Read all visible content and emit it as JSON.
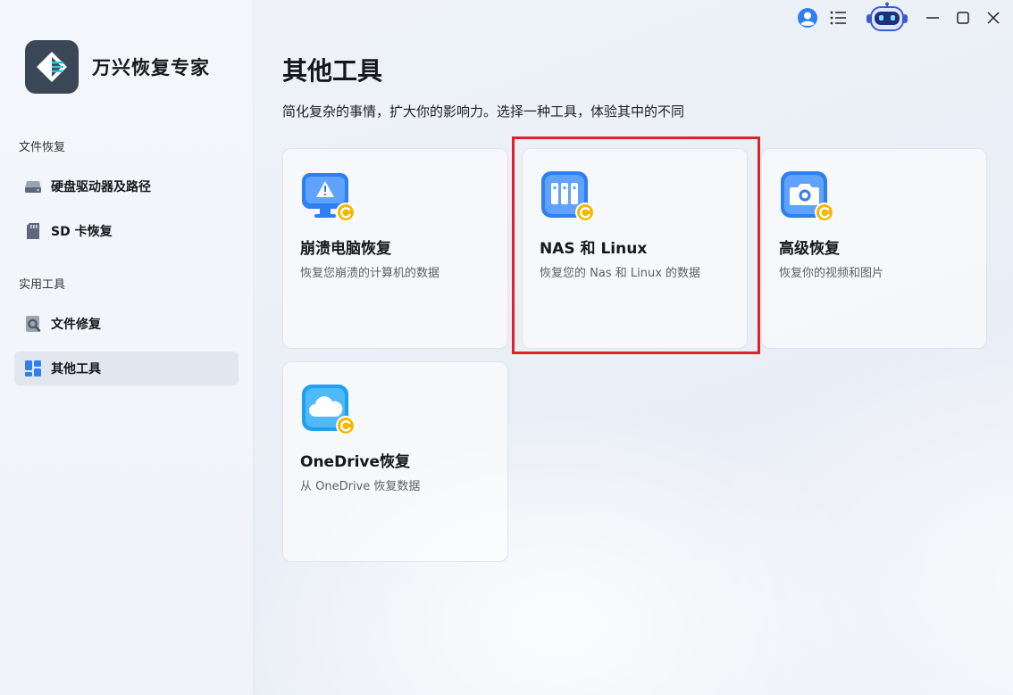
{
  "app": {
    "name": "万兴恢复专家"
  },
  "sidebar": {
    "sections": [
      {
        "label": "文件恢复"
      },
      {
        "label": "实用工具"
      }
    ],
    "items": [
      {
        "label": "硬盘驱动器及路径",
        "icon": "hard-drive-icon"
      },
      {
        "label": "SD 卡恢复",
        "icon": "sd-card-icon"
      },
      {
        "label": "文件修复",
        "icon": "file-repair-icon"
      },
      {
        "label": "其他工具",
        "icon": "grid-icon",
        "active": true
      }
    ]
  },
  "main": {
    "title": "其他工具",
    "subtitle": "简化复杂的事情，扩大你的影响力。选择一种工具，体验其中的不同",
    "cards": [
      {
        "title": "崩溃电脑恢复",
        "desc": "恢复您崩溃的计算机的数据",
        "icon": "crashed-computer-icon"
      },
      {
        "title": "NAS 和 Linux",
        "desc": "恢复您的 Nas 和 Linux 的数据",
        "icon": "nas-server-icon",
        "highlighted": true
      },
      {
        "title": "高级恢复",
        "desc": "恢复你的视频和图片",
        "icon": "camera-icon"
      },
      {
        "title": "OneDrive恢复",
        "desc": "从 OneDrive 恢复数据",
        "icon": "cloud-icon"
      }
    ]
  },
  "colors": {
    "accent_blue": "#3a8cf6",
    "badge_yellow": "#f5b800",
    "highlight_red": "#e0202a",
    "logo_bg": "#3b4656"
  }
}
